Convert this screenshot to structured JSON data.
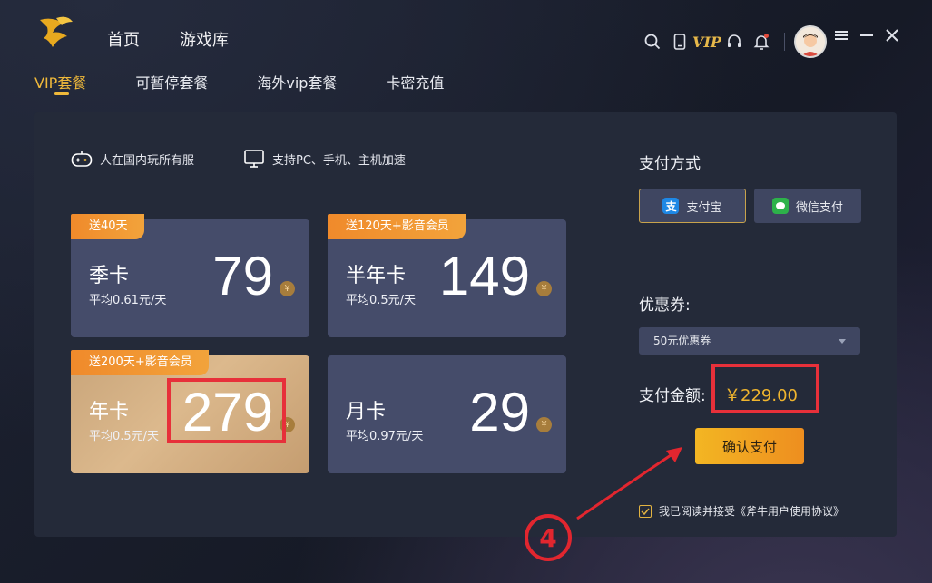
{
  "nav": {
    "home": "首页",
    "library": "游戏库"
  },
  "top_icons": {
    "vip": "VIP"
  },
  "tabs": [
    "VIP套餐",
    "可暂停套餐",
    "海外vip套餐",
    "卡密充值"
  ],
  "features": [
    "人在国内玩所有服",
    "支持PC、手机、主机加速"
  ],
  "plans": [
    {
      "badge": "送40天",
      "name": "季卡",
      "avg": "平均0.61元/天",
      "price": "79"
    },
    {
      "badge": "送120天+影音会员",
      "name": "半年卡",
      "avg": "平均0.5元/天",
      "price": "149"
    },
    {
      "badge": "送200天+影音会员",
      "name": "年卡",
      "avg": "平均0.5元/天",
      "price": "279"
    },
    {
      "badge": "",
      "name": "月卡",
      "avg": "平均0.97元/天",
      "price": "29"
    }
  ],
  "coin_symbol": "¥",
  "payment": {
    "title": "支付方式",
    "alipay": "支付宝",
    "wechat": "微信支付",
    "coupon_label": "优惠券:",
    "coupon_value": "50元优惠券",
    "amount_label": "支付金额:",
    "amount": "￥229.00",
    "confirm": "确认支付",
    "agreement": "我已阅读并接受《斧牛用户使用协议》"
  },
  "annotation_step": "4",
  "colors": {
    "accent": "#f0b93a",
    "highlight": "#e7303a",
    "alipay": "#1e88e5",
    "wechat": "#2db24a"
  }
}
